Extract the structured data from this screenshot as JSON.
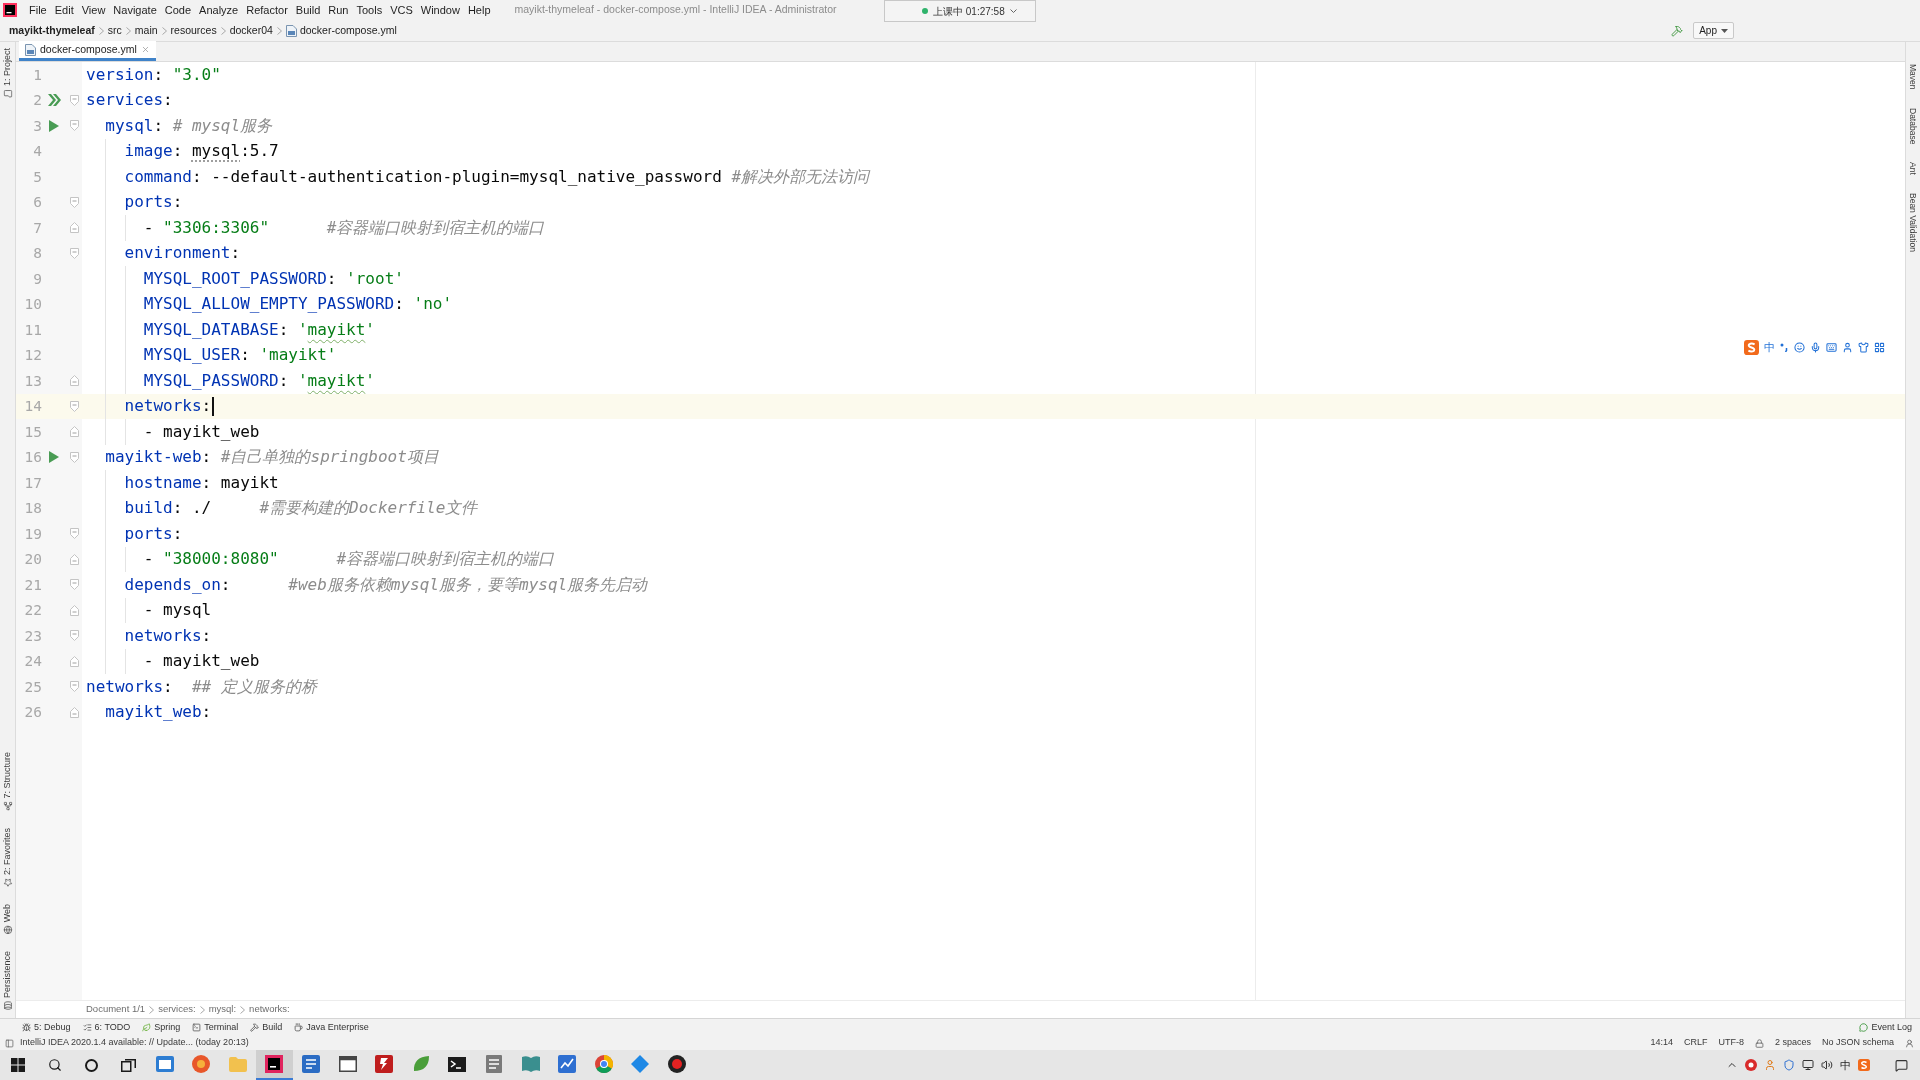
{
  "menu_bar": {
    "items": [
      "File",
      "Edit",
      "View",
      "Navigate",
      "Code",
      "Analyze",
      "Refactor",
      "Build",
      "Run",
      "Tools",
      "VCS",
      "Window",
      "Help"
    ],
    "title": "mayikt-thymeleaf - docker-compose.yml - IntelliJ IDEA - Administrator"
  },
  "recording_status": {
    "text": "上课中 01:27:58"
  },
  "navigation_bar": {
    "crumbs": [
      {
        "label": "mayikt-thymeleaf",
        "kind": "project"
      },
      {
        "label": "src",
        "kind": "folder"
      },
      {
        "label": "main",
        "kind": "folder"
      },
      {
        "label": "resources",
        "kind": "folder"
      },
      {
        "label": "docker04",
        "kind": "folder"
      },
      {
        "label": "docker-compose.yml",
        "kind": "file"
      }
    ],
    "run_config": "App"
  },
  "editor_tabs": [
    {
      "label": "docker-compose.yml",
      "selected": true
    }
  ],
  "left_tool_strip": {
    "top": [
      {
        "label": "1: Project",
        "kind": "project"
      }
    ],
    "bottom": [
      {
        "label": "7: Structure",
        "kind": "structure"
      },
      {
        "label": "2: Favorites",
        "kind": "favorites"
      },
      {
        "label": "Web",
        "kind": "web"
      },
      {
        "label": "Persistence",
        "kind": "persistence"
      }
    ]
  },
  "right_tool_strip": [
    "Maven",
    "Database",
    "Ant",
    "Bean Validation"
  ],
  "editor": {
    "lines": [
      {
        "number": "1",
        "current": false,
        "tokens": [
          {
            "kind": "key",
            "text": "version"
          },
          {
            "kind": "plain",
            "text": ": "
          },
          {
            "kind": "string",
            "text": "\"3.0\""
          }
        ]
      },
      {
        "number": "2",
        "current": false,
        "run_all_marker": true,
        "fold_start": true,
        "tokens": [
          {
            "kind": "key",
            "text": "services"
          },
          {
            "kind": "plain",
            "text": ":"
          }
        ],
        "children": [
          {
            "number": "3",
            "current": false,
            "run_marker": true,
            "fold_start": true,
            "tokens": [
              {
                "kind": "key",
                "text": "mysql"
              },
              {
                "kind": "plain",
                "text": ": "
              },
              {
                "kind": "comment",
                "text": "# mysql服务"
              }
            ],
            "children": [
              {
                "number": "4",
                "current": false,
                "tokens": [
                  {
                    "kind": "key",
                    "text": "image"
                  },
                  {
                    "kind": "plain",
                    "text": ": "
                  },
                  {
                    "kind": "plain",
                    "text": "mysql",
                    "underlined": true
                  },
                  {
                    "kind": "plain",
                    "text": ":5.7"
                  }
                ]
              },
              {
                "number": "5",
                "current": false,
                "tokens": [
                  {
                    "kind": "key",
                    "text": "command"
                  },
                  {
                    "kind": "plain",
                    "text": ": --default-authentication-plugin=mysql_native_password "
                  },
                  {
                    "kind": "comment",
                    "text": "#解决外部无法访问"
                  }
                ]
              },
              {
                "number": "6",
                "current": false,
                "fold_start": true,
                "tokens": [
                  {
                    "kind": "key",
                    "text": "ports"
                  },
                  {
                    "kind": "plain",
                    "text": ":"
                  }
                ],
                "children": [
                  {
                    "number": "7",
                    "current": false,
                    "fold_end": true,
                    "tokens": [
                      {
                        "kind": "plain",
                        "text": "- "
                      },
                      {
                        "kind": "string",
                        "text": "\"3306:3306\""
                      },
                      {
                        "kind": "comment",
                        "text": "      #容器端口映射到宿主机的端口"
                      }
                    ]
                  }
                ]
              },
              {
                "number": "8",
                "current": false,
                "fold_start": true,
                "tokens": [
                  {
                    "kind": "key",
                    "text": "environment"
                  },
                  {
                    "kind": "plain",
                    "text": ":"
                  }
                ],
                "children": [
                  {
                    "number": "9",
                    "current": false,
                    "tokens": [
                      {
                        "kind": "key",
                        "text": "MYSQL_ROOT_PASSWORD"
                      },
                      {
                        "kind": "plain",
                        "text": ": "
                      },
                      {
                        "kind": "string",
                        "text": "'root'"
                      }
                    ]
                  },
                  {
                    "number": "10",
                    "current": false,
                    "tokens": [
                      {
                        "kind": "key",
                        "text": "MYSQL_ALLOW_EMPTY_PASSWORD"
                      },
                      {
                        "kind": "plain",
                        "text": ": "
                      },
                      {
                        "kind": "string",
                        "text": "'no'"
                      }
                    ]
                  },
                  {
                    "number": "11",
                    "current": false,
                    "tokens": [
                      {
                        "kind": "key",
                        "text": "MYSQL_DATABASE"
                      },
                      {
                        "kind": "plain",
                        "text": ": "
                      },
                      {
                        "kind": "string",
                        "text": "'"
                      },
                      {
                        "kind": "string",
                        "text": "mayikt",
                        "misspelled": true
                      },
                      {
                        "kind": "string",
                        "text": "'"
                      }
                    ]
                  },
                  {
                    "number": "12",
                    "current": false,
                    "tokens": [
                      {
                        "kind": "key",
                        "text": "MYSQL_USER"
                      },
                      {
                        "kind": "plain",
                        "text": ": "
                      },
                      {
                        "kind": "string",
                        "text": "'mayikt'"
                      }
                    ]
                  },
                  {
                    "number": "13",
                    "current": false,
                    "fold_end": true,
                    "tokens": [
                      {
                        "kind": "key",
                        "text": "MYSQL_PASSWORD"
                      },
                      {
                        "kind": "plain",
                        "text": ": "
                      },
                      {
                        "kind": "string",
                        "text": "'"
                      },
                      {
                        "kind": "string",
                        "text": "mayikt",
                        "misspelled": true
                      },
                      {
                        "kind": "string",
                        "text": "'"
                      }
                    ]
                  }
                ]
              },
              {
                "number": "14",
                "current": true,
                "fold_start": true,
                "tokens": [
                  {
                    "kind": "key",
                    "text": "networks"
                  },
                  {
                    "kind": "plain",
                    "text": ":"
                  }
                ],
                "children": [
                  {
                    "number": "15",
                    "current": false,
                    "fold_end": true,
                    "tokens": [
                      {
                        "kind": "plain",
                        "text": "- mayikt_web"
                      }
                    ]
                  }
                ]
              }
            ]
          },
          {
            "number": "16",
            "current": false,
            "run_marker": true,
            "fold_start": true,
            "tokens": [
              {
                "kind": "key",
                "text": "mayikt-web"
              },
              {
                "kind": "plain",
                "text": ": "
              },
              {
                "kind": "comment",
                "text": "#自己单独的springboot项目"
              }
            ],
            "children": [
              {
                "number": "17",
                "current": false,
                "tokens": [
                  {
                    "kind": "key",
                    "text": "hostname"
                  },
                  {
                    "kind": "plain",
                    "text": ": mayikt"
                  }
                ]
              },
              {
                "number": "18",
                "current": false,
                "tokens": [
                  {
                    "kind": "key",
                    "text": "build"
                  },
                  {
                    "kind": "plain",
                    "text": ": ./     "
                  },
                  {
                    "kind": "comment",
                    "text": "#需要构建的Dockerfile文件"
                  }
                ]
              },
              {
                "number": "19",
                "current": false,
                "fold_start": true,
                "tokens": [
                  {
                    "kind": "key",
                    "text": "ports"
                  },
                  {
                    "kind": "plain",
                    "text": ":"
                  }
                ],
                "children": [
                  {
                    "number": "20",
                    "current": false,
                    "fold_end": true,
                    "tokens": [
                      {
                        "kind": "plain",
                        "text": "- "
                      },
                      {
                        "kind": "string",
                        "text": "\"38000:8080\""
                      },
                      {
                        "kind": "comment",
                        "text": "      #容器端口映射到宿主机的端口"
                      }
                    ]
                  }
                ]
              },
              {
                "number": "21",
                "current": false,
                "fold_start": true,
                "tokens": [
                  {
                    "kind": "key",
                    "text": "depends_on"
                  },
                  {
                    "kind": "plain",
                    "text": ":      "
                  },
                  {
                    "kind": "comment",
                    "text": "#web服务依赖mysql服务，要等mysql服务先启动"
                  }
                ],
                "children": [
                  {
                    "number": "22",
                    "current": false,
                    "fold_end": true,
                    "tokens": [
                      {
                        "kind": "plain",
                        "text": "- mysql"
                      }
                    ]
                  }
                ]
              },
              {
                "number": "23",
                "current": false,
                "fold_start": true,
                "tokens": [
                  {
                    "kind": "key",
                    "text": "networks"
                  },
                  {
                    "kind": "plain",
                    "text": ":"
                  }
                ],
                "children": [
                  {
                    "number": "24",
                    "current": false,
                    "fold_end": true,
                    "tokens": [
                      {
                        "kind": "plain",
                        "text": "- mayikt_web"
                      }
                    ]
                  }
                ]
              }
            ]
          }
        ]
      },
      {
        "number": "25",
        "current": false,
        "fold_start": true,
        "tokens": [
          {
            "kind": "key",
            "text": "networks"
          },
          {
            "kind": "plain",
            "text": ":  "
          },
          {
            "kind": "comment",
            "text": "## 定义服务的桥"
          }
        ],
        "children": [
          {
            "number": "26",
            "current": false,
            "fold_end": true,
            "tokens": [
              {
                "kind": "key",
                "text": "mayikt_web"
              },
              {
                "kind": "plain",
                "text": ":"
              }
            ]
          }
        ]
      }
    ]
  },
  "editor_breadcrumbs": [
    "Document 1/1",
    "services:",
    "mysql:",
    "networks:"
  ],
  "tool_windows": [
    {
      "label": "5: Debug",
      "kind": "debug"
    },
    {
      "label": "6: TODO",
      "kind": "todo"
    },
    {
      "label": "Spring",
      "kind": "spring"
    },
    {
      "label": "Terminal",
      "kind": "terminal"
    },
    {
      "label": "Build",
      "kind": "build"
    },
    {
      "label": "Java Enterprise",
      "kind": "enterprise"
    }
  ],
  "event_log": "Event Log",
  "status_bar": {
    "message": "IntelliJ IDEA 2020.1.4 available: // Update... (today 20:13)",
    "items": [
      "14:14",
      "CRLF",
      "UTF-8",
      "2 spaces",
      "No JSON schema"
    ]
  },
  "ime_toolbar": {
    "mode": "中"
  },
  "taskbar": {
    "apps": [
      {
        "kind": "window",
        "selected": false
      },
      {
        "kind": "disc",
        "selected": false
      },
      {
        "kind": "folder",
        "selected": false
      },
      {
        "kind": "tile",
        "selected": true
      },
      {
        "kind": "document",
        "selected": false
      },
      {
        "kind": "panel",
        "selected": false
      },
      {
        "kind": "bolt",
        "selected": false
      },
      {
        "kind": "leaf",
        "selected": false
      },
      {
        "kind": "terminal",
        "selected": false
      },
      {
        "kind": "notes",
        "selected": false
      },
      {
        "kind": "book",
        "selected": false
      },
      {
        "kind": "chart",
        "selected": false
      },
      {
        "kind": "wheel",
        "selected": false
      },
      {
        "kind": "diamond",
        "selected": false
      },
      {
        "kind": "record",
        "selected": false
      }
    ],
    "ime": "中"
  }
}
